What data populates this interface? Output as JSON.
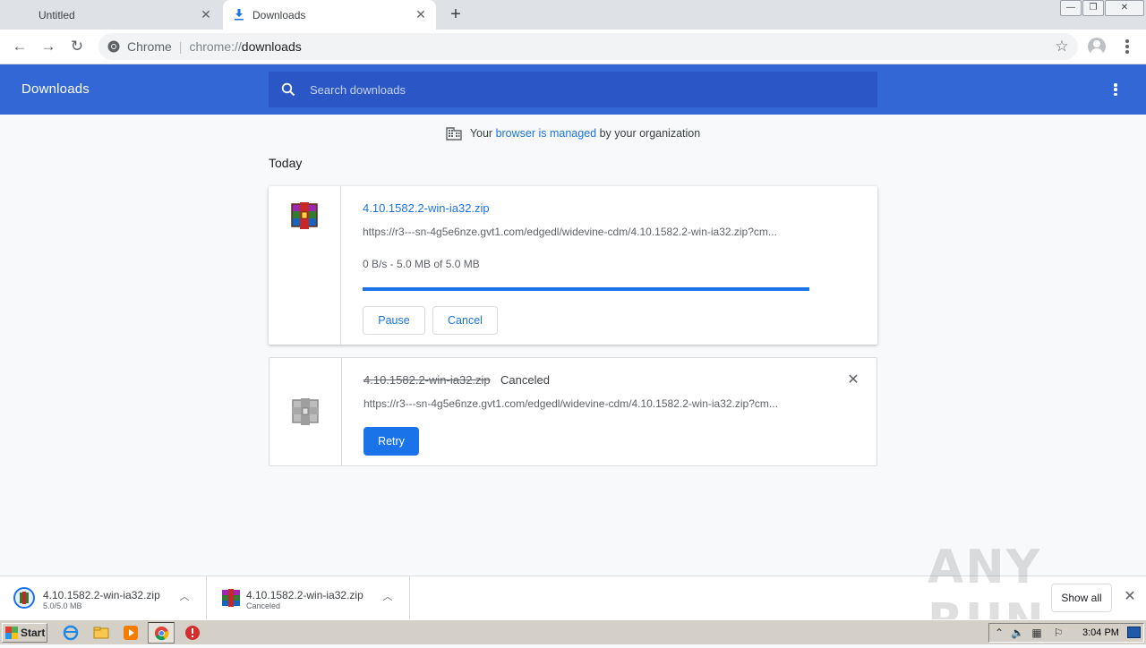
{
  "browser": {
    "tabs": [
      {
        "label": "Untitled",
        "active": false
      },
      {
        "label": "Downloads",
        "active": true
      }
    ],
    "omnibox": {
      "chip": "Chrome",
      "scheme": "chrome://",
      "host": "downloads"
    }
  },
  "page": {
    "title": "Downloads",
    "search_placeholder": "Search downloads",
    "managed": {
      "prefix": "Your ",
      "link": "browser is managed",
      "suffix": " by your organization"
    },
    "section_label": "Today"
  },
  "downloads": [
    {
      "filename": "4.10.1582.2-win-ia32.zip",
      "url": "https://r3---sn-4g5e6nze.gvt1.com/edgedl/widevine-cdm/4.10.1582.2-win-ia32.zip?cm...",
      "progress_text": "0 B/s - 5.0 MB of 5.0 MB",
      "progress": 1.0,
      "buttons": {
        "pause": "Pause",
        "cancel": "Cancel"
      }
    },
    {
      "filename": "4.10.1582.2-win-ia32.zip",
      "status": "Canceled",
      "url": "https://r3---sn-4g5e6nze.gvt1.com/edgedl/widevine-cdm/4.10.1582.2-win-ia32.zip?cm...",
      "buttons": {
        "retry": "Retry"
      }
    }
  ],
  "shelf": {
    "items": [
      {
        "name": "4.10.1582.2-win-ia32.zip",
        "status": "5.0/5.0 MB"
      },
      {
        "name": "4.10.1582.2-win-ia32.zip",
        "status": "Canceled"
      }
    ],
    "show_all": "Show all",
    "watermark": "ANY RUN"
  },
  "taskbar": {
    "start": "Start",
    "clock": "3:04 PM"
  },
  "colors": {
    "header_blue": "#3367d6",
    "accent": "#1a73e8"
  }
}
